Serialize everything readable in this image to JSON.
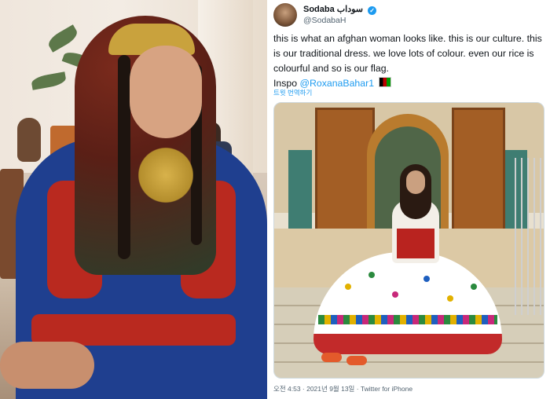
{
  "tweet": {
    "display_name": "Sodaba",
    "display_name_arabic": "سوداب",
    "handle": "@SodabaH",
    "verified_badge": "✓",
    "text_part1": "this is what an afghan woman looks like. this is our culture. this is our traditional dress. we love lots of colour. even our rice is colourful and so is our flag.",
    "text_inspo": "Inspo",
    "mention": "@RoxanaBahar1",
    "flag_icon": "afghanistan-flag-emoji",
    "translate_link": "트윗 번역하기",
    "meta": "오전 4:53 · 2021년 9월 13일 · Twitter for iPhone"
  },
  "colors": {
    "link": "#1d9bf0",
    "text": "#0f1419",
    "muted": "#536471"
  }
}
